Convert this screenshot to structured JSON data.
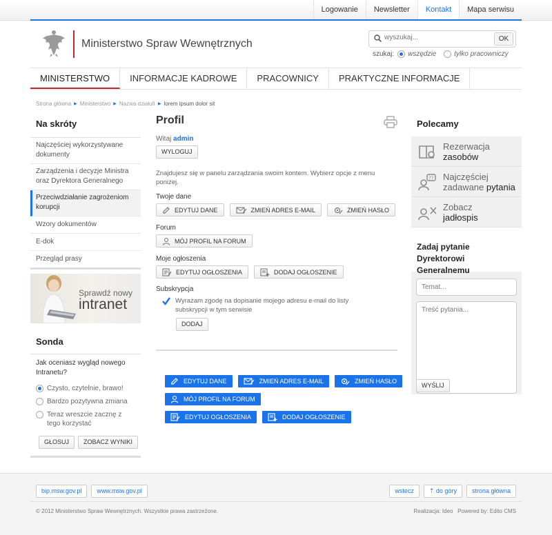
{
  "top_links": [
    "Logowanie",
    "Newsletter",
    "Kontakt",
    "Mapa serwisu"
  ],
  "top_links_active": "Kontakt",
  "site_title": "Ministerstwo Spraw Wewnętrznych",
  "search": {
    "placeholder": "wyszukaj...",
    "ok": "OK",
    "scope_label": "szukaj:",
    "scope_options": [
      "wszędzie",
      "tylko pracowniczy"
    ],
    "selected": "wszędzie"
  },
  "main_nav": [
    "MINISTERSTWO",
    "INFORMACJE KADROWE",
    "PRACOWNICY",
    "PRAKTYCZNE INFORMACJE"
  ],
  "breadcrumb": [
    "Strona główna",
    "Ministerstwo",
    "Nazwa działuII",
    "lorem ipsum dolor sit"
  ],
  "shortcuts": {
    "title": "Na skróty",
    "items": [
      "Najczęściej wykorzystywane dokumenty",
      "Zarządzenia i decyzje Ministra oraz Dyrektora Generalnego",
      "Przeciwdziałanie zagrożeniom korupcji",
      "Wzory dokumentów",
      "E-dok",
      "Przegląd prasy"
    ],
    "active_index": 2
  },
  "banner": {
    "line1": "Sprawdź nowy",
    "line2": "intranet"
  },
  "poll": {
    "title": "Sonda",
    "question": "Jak oceniasz wygląd nowego Intranetu?",
    "options": [
      "Czysto, czytelnie, brawo!",
      "Bardzo pozytywna zmiana",
      "Teraz wreszcie zacznę z tego korzystać"
    ],
    "selected_index": 0,
    "vote": "GŁOSUJ",
    "results": "ZOBACZ WYNIKI"
  },
  "profile": {
    "title": "Profil",
    "welcome": "Witaj",
    "username": "admin",
    "logout": "WYLOGUJ",
    "intro": "Znajdujesz się w panelu zarządzania swoim kontem. Wybierz opcje z menu poniżej.",
    "sections": {
      "data": "Twoje dane",
      "forum": "Forum",
      "ads": "Moje ogłoszenia",
      "subscription": "Subskrypcja"
    },
    "buttons": {
      "edit_data": "EDYTUJ DANE",
      "change_email": "ZMIEŃ ADRES E-MAIL",
      "change_password": "ZMIEŃ HASŁO",
      "forum_profile": "MÓJ PROFIL NA FORUM",
      "edit_ads": "EDYTUJ OGŁOSZENIA",
      "add_ad": "DODAJ OGŁOSZENIE",
      "add": "DODAJ"
    },
    "subscription_text": "Wyrażam zgodę na dopisanie mojego adresu e-mail do listy subskrypcji w tym serwisie",
    "subscription_checked": true
  },
  "recommended": {
    "title": "Polecamy",
    "items": [
      {
        "line1": "Rezerwacja",
        "line2": "zasobów"
      },
      {
        "line1": "Najczęściej",
        "line2a": "zadawane ",
        "line2": "pytania"
      },
      {
        "line1": "Zobacz",
        "line2": "jadłospis"
      }
    ]
  },
  "ask": {
    "title": "Zadaj pytanie Dyrektorowi Generalnemu",
    "subject_placeholder": "Temat...",
    "body_placeholder": "Treść pytania...",
    "send": "WYŚLIJ"
  },
  "footer": {
    "links_left": [
      "bip.msw.gov.pl",
      "www.msw.gov.pl"
    ],
    "links_right": [
      "wstecz",
      "do góry",
      "strona główna"
    ],
    "copyright": "© 2012 Ministerstwo Spraw Wewnętrznych. Wszystkie prawa zastrzeżone.",
    "realization": "Realizacja: Ideo",
    "powered": "Powered by: Edito CMS"
  },
  "colors": {
    "accent": "#1a73e8",
    "brand_red": "#c6262e"
  }
}
